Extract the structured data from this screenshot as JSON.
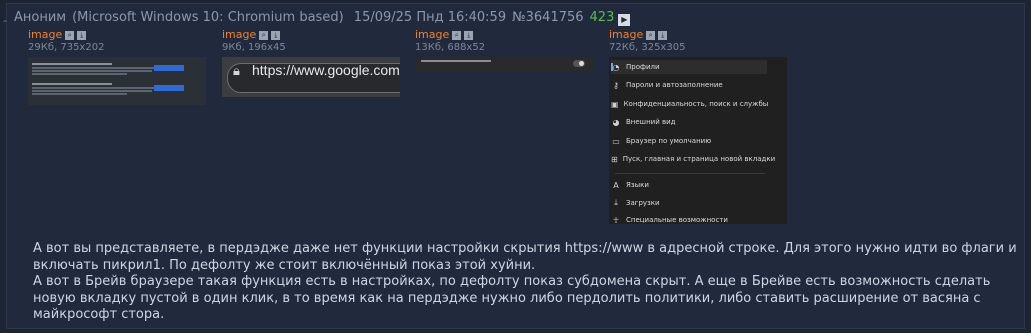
{
  "post": {
    "author": "Аноним",
    "agent": "(Microsoft Windows 10: Chromium based)",
    "datetime": "15/09/25 Пнд 16:40:59",
    "number": "№3641756",
    "count": "423",
    "play_icon": "▶"
  },
  "files": [
    {
      "name": "image",
      "meta": "29Кб, 735x202"
    },
    {
      "name": "image",
      "meta": "9Кб, 196x45",
      "url_text": "https://www.google.com/"
    },
    {
      "name": "image",
      "meta": "13Кб, 688x52"
    },
    {
      "name": "image",
      "meta": "72Кб, 325x305",
      "menu": [
        "Профили",
        "Пароли и автозаполнение",
        "Конфиденциальность, поиск и службы",
        "Внешний вид",
        "Браузер по умолчанию",
        "Пуск, главная и страница новой вкладки",
        "Языки",
        "Загрузки",
        "Специальные возможности"
      ]
    }
  ],
  "message": "А вот вы представляете, в пердэдже даже нет функции настройки скрытия https://www в адресной строке. Для этого нужно идти во флаги и включать пикрил1. По дефолту же стоит включённый показ этой хуйни.\nА вот в Брейв браузере такая функция есть в настройках, по дефолту показ субдомена скрыт. А еще в Брейве есть возможность сделать новую вкладку пустой в один клик, в то время как на пердэдже нужно либо пердолить политики, либо ставить расширение от васяна с майкрософт стора."
}
